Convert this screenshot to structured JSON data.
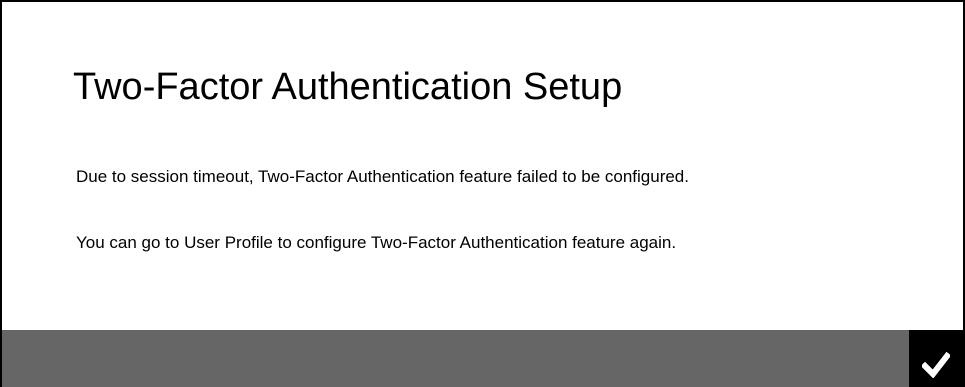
{
  "dialog": {
    "title": "Two-Factor Authentication Setup",
    "messages": [
      "Due to session timeout, Two-Factor Authentication feature failed to be configured.",
      "You can go to User Profile to configure Two-Factor Authentication feature again."
    ]
  },
  "footer": {
    "confirm_icon": "check-icon"
  },
  "colors": {
    "background": "#ffffff",
    "border": "#000000",
    "footer_bar": "#666666",
    "confirm_button": "#000000",
    "check_mark": "#ffffff"
  }
}
